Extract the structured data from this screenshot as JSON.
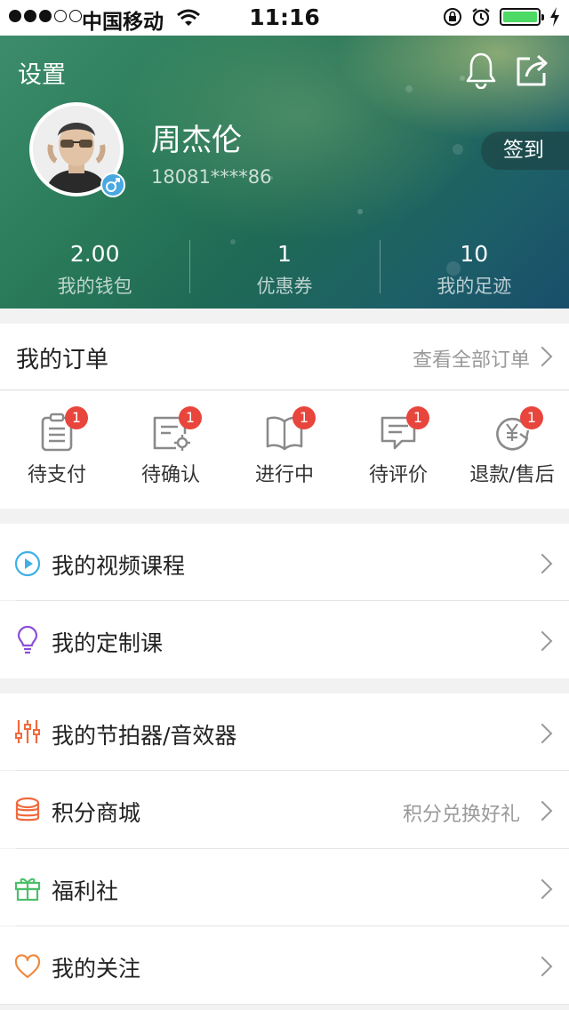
{
  "status_bar": {
    "carrier": "中国移动",
    "time": "11:16"
  },
  "header": {
    "settings_label": "设置",
    "username": "周杰伦",
    "phone": "18081****86",
    "signin_label": "签到",
    "stats": [
      {
        "value": "2.00",
        "label": "我的钱包"
      },
      {
        "value": "1",
        "label": "优惠券"
      },
      {
        "value": "10",
        "label": "我的足迹"
      }
    ]
  },
  "orders": {
    "title": "我的订单",
    "view_all": "查看全部订单",
    "items": [
      {
        "label": "待支付",
        "badge": "1",
        "icon": "clipboard-icon"
      },
      {
        "label": "待确认",
        "badge": "1",
        "icon": "document-gear-icon"
      },
      {
        "label": "进行中",
        "badge": "1",
        "icon": "open-book-icon"
      },
      {
        "label": "待评价",
        "badge": "1",
        "icon": "comment-icon"
      },
      {
        "label": "退款/售后",
        "badge": "1",
        "icon": "yen-refund-icon"
      }
    ]
  },
  "menu": {
    "video_courses": "我的视频课程",
    "custom_courses": "我的定制课",
    "metronome": "我的节拍器/音效器",
    "points_mall": "积分商城",
    "points_mall_extra": "积分兑换好礼",
    "welfare": "福利社",
    "follows": "我的关注"
  },
  "colors": {
    "badge": "#e8453c",
    "video_icon": "#3fb0e8",
    "custom_icon": "#8a4fd6",
    "metronome_icon": "#f06a3d",
    "points_icon": "#f06a3d",
    "welfare_icon": "#4cbf6a",
    "follow_icon": "#f0893d"
  }
}
